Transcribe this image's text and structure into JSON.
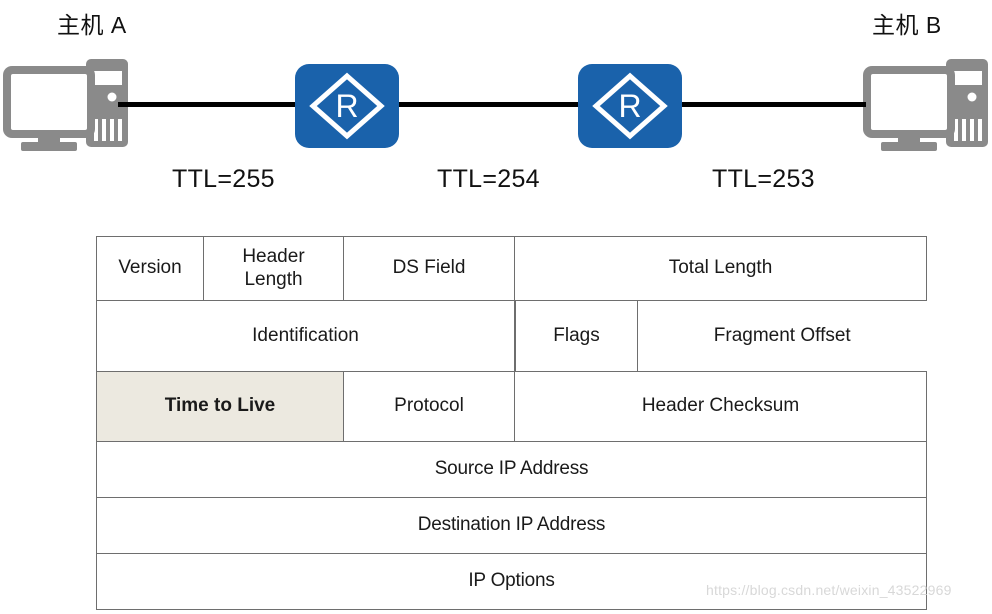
{
  "topology": {
    "host_a_label": "主机 A",
    "host_b_label": "主机 B",
    "router_glyph": "R",
    "ttl_labels": [
      "TTL=255",
      "TTL=254",
      "TTL=253"
    ],
    "colors": {
      "router_blue": "#1a62ab",
      "pc_gray": "#8a8a8a",
      "link_black": "#000000"
    }
  },
  "ip_header": {
    "rows": [
      {
        "cells": [
          {
            "label": "Version",
            "highlight": false
          },
          {
            "label": "Header\nLength",
            "highlight": false
          },
          {
            "label": "DS Field",
            "highlight": false
          },
          {
            "label": "Total Length",
            "highlight": false
          }
        ]
      },
      {
        "cells": [
          {
            "label": "Identification",
            "highlight": false
          },
          {
            "label": "Flags",
            "highlight": false
          },
          {
            "label": "Fragment Offset",
            "highlight": false
          }
        ]
      },
      {
        "cells": [
          {
            "label": "Time to Live",
            "highlight": true
          },
          {
            "label": "Protocol",
            "highlight": false
          },
          {
            "label": "Header Checksum",
            "highlight": false
          }
        ]
      },
      {
        "cells": [
          {
            "label": "Source IP Address",
            "highlight": false
          }
        ]
      },
      {
        "cells": [
          {
            "label": "Destination IP Address",
            "highlight": false
          }
        ]
      },
      {
        "cells": [
          {
            "label": "IP  Options",
            "highlight": false
          }
        ]
      }
    ],
    "colors": {
      "highlight_background": "#ece9e0",
      "highlight_text": "#ff0000",
      "border": "#6e6e6e"
    }
  },
  "watermark": {
    "text": "https://blog.csdn.net/weixin_43522969"
  }
}
